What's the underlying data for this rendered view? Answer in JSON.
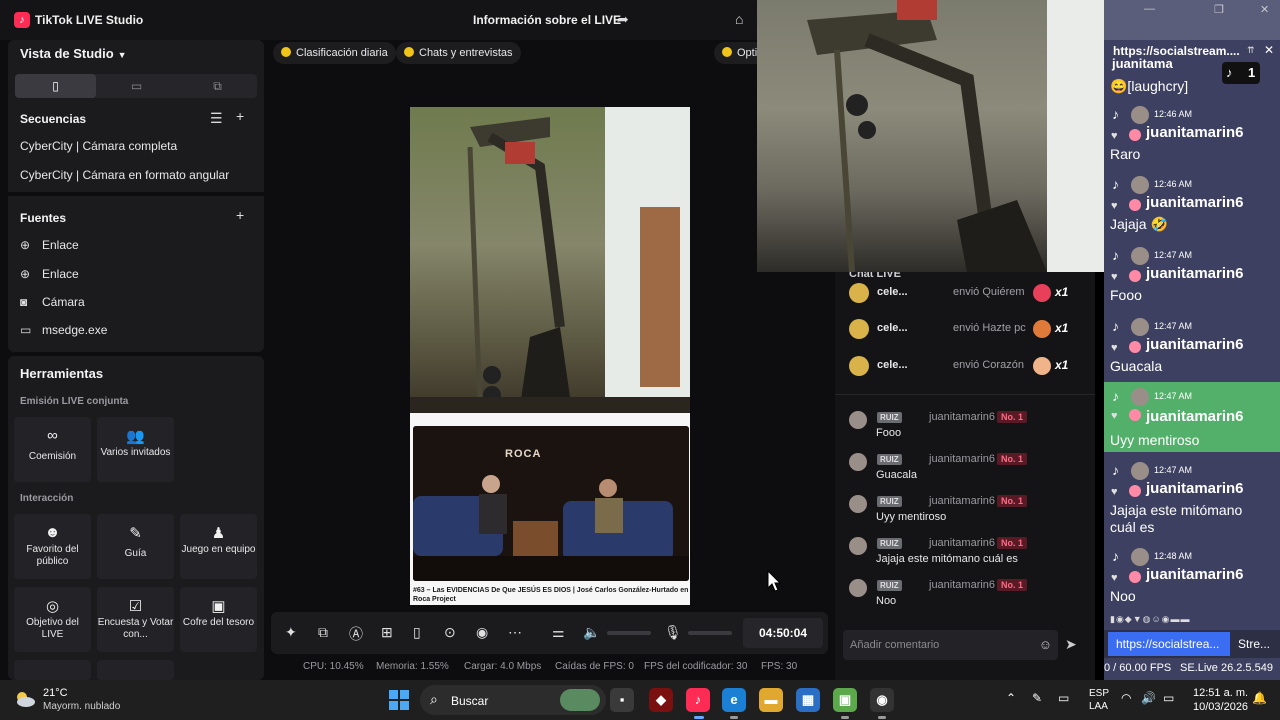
{
  "titlebar": {
    "app_title": "TikTok LIVE Studio",
    "live_info": "Información sobre el LIVE"
  },
  "sidebar": {
    "studio_view": "Vista de Studio",
    "scenes_header": "Secuencias",
    "scenes": [
      "CyberCity | Cámara completa",
      "CyberCity | Cámara en formato angular"
    ],
    "sources_header": "Fuentes",
    "sources": [
      {
        "label": "Enlace",
        "icon": "globe-icon"
      },
      {
        "label": "Enlace",
        "icon": "globe-icon"
      },
      {
        "label": "Cámara",
        "icon": "camera-icon"
      },
      {
        "label": "msedge.exe",
        "icon": "window-icon"
      }
    ],
    "tools_header": "Herramientas",
    "cohost_header": "Emisión LIVE conjunta",
    "cohost_tools": [
      "Coemisión",
      "Varios invitados"
    ],
    "interaction_header": "Interacción",
    "interaction_tools": [
      "Favorito del público",
      "Guía",
      "Juego en equipo",
      "Objetivo del LIVE",
      "Encuesta y Votar con...",
      "Cofre del tesoro"
    ]
  },
  "center": {
    "chips": [
      "Clasificación diaria",
      "Chats y entrevistas",
      "Opti"
    ],
    "podcast_logo": "ROCA",
    "podcast_caption": "#63 – Las EVIDENCIAS De Que JESÚS ES DIOS | José Carlos González-Hurtado en Roca Project",
    "timer": "04:50:04",
    "stats": [
      "CPU: 10.45%",
      "Memoria: 1.55%",
      "Cargar: 4.0 Mbps",
      "Caídas de FPS: 0",
      "FPS del codificador: 30",
      "FPS: 30"
    ]
  },
  "chat": {
    "title": "Chat LIVE",
    "gifts": [
      {
        "user": "cele...",
        "sent": "envió Quiérem",
        "count": "x1",
        "color": "#e8405a"
      },
      {
        "user": "cele...",
        "sent": "envió Hazte pc",
        "count": "x1",
        "color": "#e07a3a"
      },
      {
        "user": "cele...",
        "sent": "envió Corazón",
        "count": "x1",
        "color": "#f0b48a"
      }
    ],
    "messages": [
      {
        "badge": "RUIZ",
        "user": "juanitamarin6",
        "rank": "No. 1",
        "text": "Fooo"
      },
      {
        "badge": "RUIZ",
        "user": "juanitamarin6",
        "rank": "No. 1",
        "text": "Guacala"
      },
      {
        "badge": "RUIZ",
        "user": "juanitamarin6",
        "rank": "No. 1",
        "text": "Uyy mentiroso"
      },
      {
        "badge": "RUIZ",
        "user": "juanitamarin6",
        "rank": "No. 1",
        "text": "Jajaja este mitómano cuál es"
      },
      {
        "badge": "RUIZ",
        "user": "juanitamarin6",
        "rank": "No. 1",
        "text": "Noo"
      }
    ],
    "comment_placeholder": "Añadir comentario"
  },
  "social_stream": {
    "url": "https://socialstream....",
    "counter": "1",
    "partial_user": "juanitama",
    "first_line": "😄[laughcry]",
    "messages": [
      {
        "time": "12:46 AM",
        "user": "juanitamarin6",
        "text": "Raro"
      },
      {
        "time": "12:46 AM",
        "user": "juanitamarin6",
        "text": "Jajaja 🤣"
      },
      {
        "time": "12:47 AM",
        "user": "juanitamarin6",
        "text": "Fooo"
      },
      {
        "time": "12:47 AM",
        "user": "juanitamarin6",
        "text": "Guacala"
      },
      {
        "time": "12:47 AM",
        "user": "juanitamarin6",
        "text": "Uyy mentiroso"
      },
      {
        "time": "12:47 AM",
        "user": "juanitamarin6",
        "text": "Jajaja este mitómano cuál es"
      },
      {
        "time": "12:48 AM",
        "user": "juanitamarin6",
        "text": "Noo"
      }
    ],
    "tab1": "https://socialstrea...",
    "tab2": "Stre...",
    "fps": "0 / 60.00 FPS",
    "version": "SE.Live 26.2.5.549"
  },
  "taskbar": {
    "temperature": "21°C",
    "weather": "Mayorm. nublado",
    "search": "Buscar",
    "lang1": "ESP",
    "lang2": "LAA",
    "time": "12:51 a. m.",
    "date": "10/03/2026"
  },
  "colors": {
    "tiktok_red": "#fe2c55",
    "highlight_green": "#53b06a",
    "panel_bg": "#1b1b1e",
    "social_bg": "#3d4060"
  }
}
